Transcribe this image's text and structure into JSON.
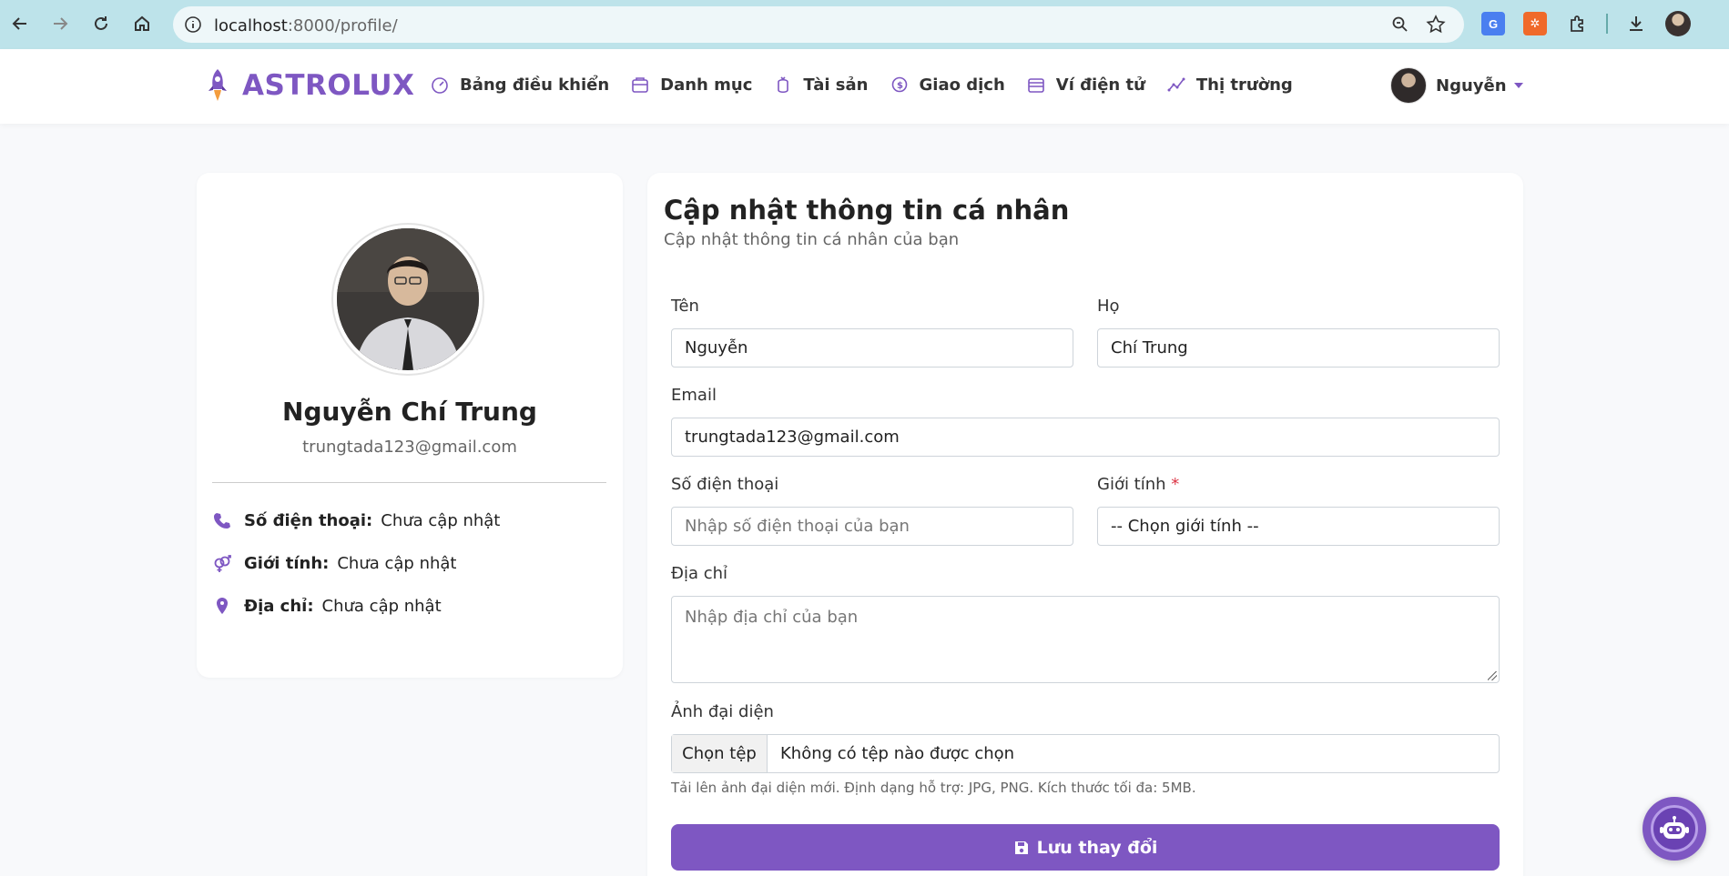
{
  "browser": {
    "url_host": "localhost",
    "url_rest": ":8000/profile/"
  },
  "header": {
    "brand": "ASTROLUX",
    "nav": [
      {
        "label": "Bảng điều khiển",
        "icon": "dashboard-icon"
      },
      {
        "label": "Danh mục",
        "icon": "portfolio-icon"
      },
      {
        "label": "Tài sản",
        "icon": "assets-icon"
      },
      {
        "label": "Giao dịch",
        "icon": "transactions-icon"
      },
      {
        "label": "Ví điện tử",
        "icon": "wallet-icon"
      },
      {
        "label": "Thị trường",
        "icon": "market-icon"
      }
    ],
    "user_name": "Nguyễn"
  },
  "profile_card": {
    "full_name": "Nguyễn Chí Trung",
    "email": "trungtada123@gmail.com",
    "phone_label": "Số điện thoại:",
    "phone_value": "Chưa cập nhật",
    "gender_label": "Giới tính:",
    "gender_value": "Chưa cập nhật",
    "address_label": "Địa chỉ:",
    "address_value": "Chưa cập nhật"
  },
  "form": {
    "title": "Cập nhật thông tin cá nhân",
    "subtitle": "Cập nhật thông tin cá nhân của bạn",
    "first_name_label": "Tên",
    "first_name_value": "Nguyễn",
    "last_name_label": "Họ",
    "last_name_value": "Chí Trung",
    "email_label": "Email",
    "email_value": "trungtada123@gmail.com",
    "phone_label": "Số điện thoại",
    "phone_placeholder": "Nhập số điện thoại của bạn",
    "gender_label": "Giới tính",
    "gender_required": "*",
    "gender_selected": "-- Chọn giới tính --",
    "address_label": "Địa chỉ",
    "address_placeholder": "Nhập địa chỉ của bạn",
    "avatar_label": "Ảnh đại diện",
    "file_button": "Chọn tệp",
    "file_status": "Không có tệp nào được chọn",
    "avatar_hint": "Tải lên ảnh đại diện mới. Định dạng hỗ trợ: JPG, PNG. Kích thước tối đa: 5MB.",
    "save_label": "Lưu thay đổi"
  },
  "colors": {
    "accent": "#7e57c2",
    "browser_bar": "#bde3ea",
    "required": "#dc3545"
  }
}
